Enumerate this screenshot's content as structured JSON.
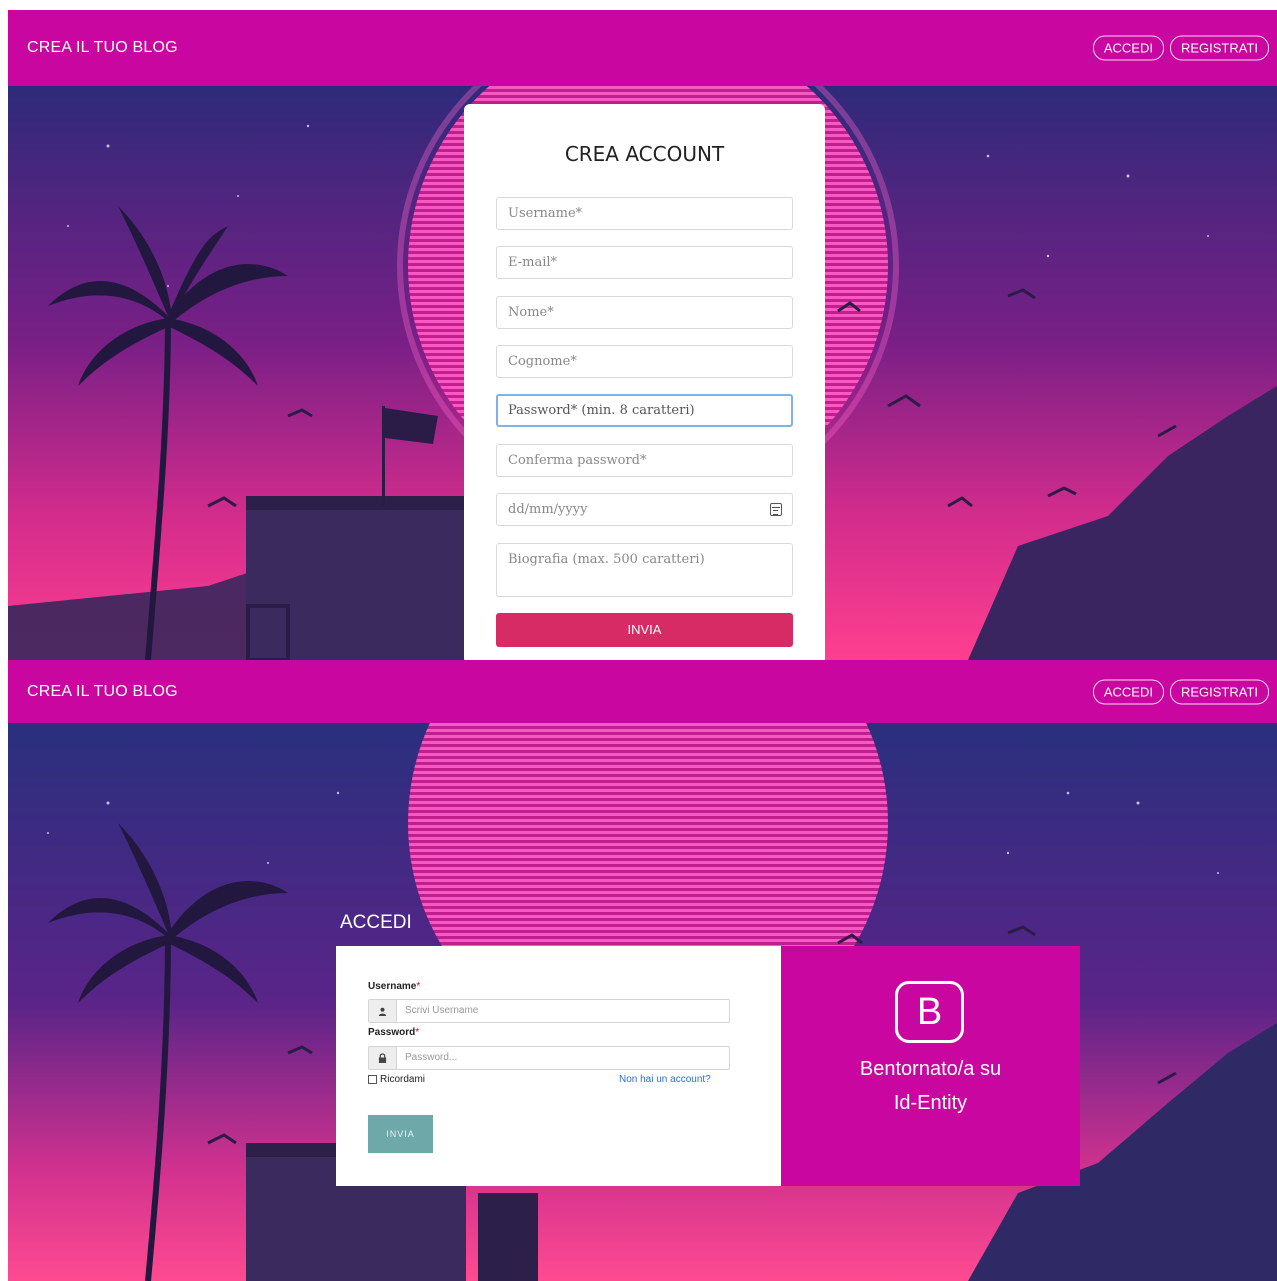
{
  "navbar": {
    "brand": "CREA IL TUO BLOG",
    "login_label": "ACCEDI",
    "register_label": "REGISTRATI"
  },
  "signup": {
    "title": "CREA ACCOUNT",
    "username_placeholder": "Username*",
    "email_placeholder": "E-mail*",
    "name_placeholder": "Nome*",
    "surname_placeholder": "Cognome*",
    "password_placeholder": "Password* (min. 8 caratteri)",
    "confirm_placeholder": "Conferma password*",
    "date_placeholder": "dd/mm/yyyy",
    "bio_placeholder": "Biografia (max. 500 caratteri)",
    "submit_label": "INVIA"
  },
  "login": {
    "heading": "ACCEDI",
    "username_label": "Username",
    "username_placeholder": "Scrivi Username",
    "password_label": "Password",
    "password_placeholder": "Password...",
    "required_mark": "*",
    "remember_label": "Ricordami",
    "no_account_link": "Non hai un account?",
    "submit_label": "INVIA",
    "side_logo": "B",
    "welcome_line1": "Bentornato/a su",
    "welcome_line2": "Id-Entity"
  },
  "colors": {
    "navbar": "#c9069f",
    "signup_button": "#d62b64",
    "login_button": "#6fa8a8",
    "side_panel": "#c9069f"
  }
}
